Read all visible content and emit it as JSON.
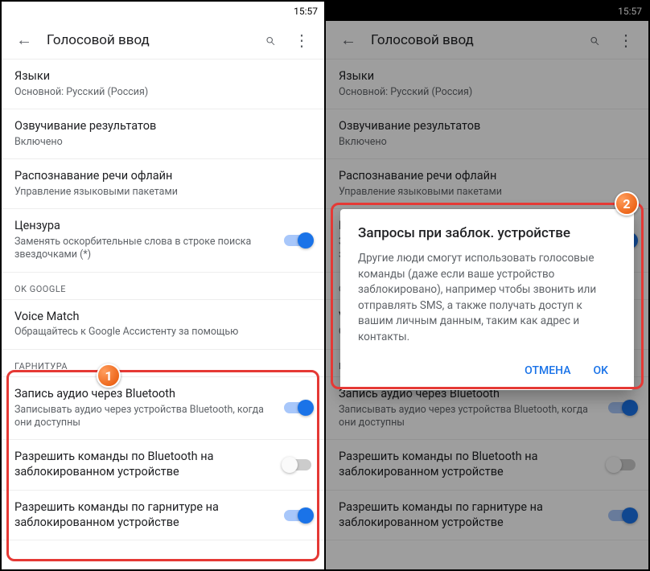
{
  "statusbar": {
    "time": "15:57"
  },
  "appbar": {
    "title": "Голосовой ввод"
  },
  "rows": {
    "languages": {
      "primary": "Языки",
      "secondary": "Основной: Русский (Россия)"
    },
    "speak": {
      "primary": "Озвучивание результатов",
      "secondary": "Включено"
    },
    "offline": {
      "primary": "Распознавание речи офлайн",
      "secondary": "Управление языковыми пакетами"
    },
    "censor": {
      "primary": "Цензура",
      "secondary": "Заменять оскорбительные слова в строке поиска звездочками (*)"
    },
    "voicematch": {
      "primary": "Voice Match",
      "secondary": "Обращайтесь к Google Ассистенту за помощью"
    },
    "bt_record": {
      "primary": "Запись аудио через Bluetooth",
      "secondary": "Записывать аудио через устройства Bluetooth, когда они доступны"
    },
    "bt_locked": {
      "primary": "Разрешить команды по Bluetooth на заблокированном устройстве"
    },
    "hs_locked": {
      "primary": "Разрешить команды по гарнитуре на заблокированном устройстве"
    }
  },
  "sections": {
    "okgoogle": "OK GOOGLE",
    "headset": "ГАРНИТУРА"
  },
  "dialog": {
    "title": "Запросы при заблок. устройстве",
    "body": "Другие люди смогут использовать голосовые команды (даже если ваше устройство заблокировано), например чтобы звонить или отправлять SMS, а также получать доступ к вашим личным данным, таким как адрес и контакты.",
    "cancel": "ОТМЕНА",
    "ok": "OK"
  },
  "badges": {
    "one": "1",
    "two": "2"
  }
}
